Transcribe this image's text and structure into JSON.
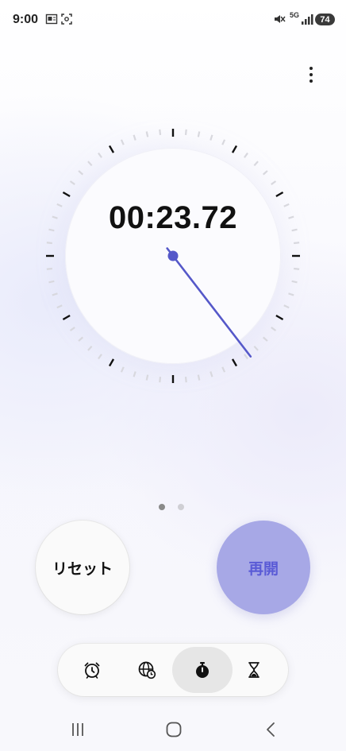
{
  "status_bar": {
    "time": "9:00",
    "battery": "74",
    "network": "5G",
    "icons": [
      "gallery-notification-icon",
      "screenshot-notification-icon",
      "mute-icon",
      "signal-icon",
      "battery-icon"
    ]
  },
  "stopwatch": {
    "time": "00:23.72",
    "elapsed_seconds": 23.72
  },
  "pager": {
    "count": 2,
    "active_index": 0
  },
  "buttons": {
    "reset_label": "リセット",
    "resume_label": "再開"
  },
  "tabs": [
    {
      "id": "alarm",
      "icon": "alarm-clock-icon",
      "active": false
    },
    {
      "id": "world-clock",
      "icon": "world-clock-icon",
      "active": false
    },
    {
      "id": "stopwatch",
      "icon": "stopwatch-icon",
      "active": true
    },
    {
      "id": "timer",
      "icon": "hourglass-icon",
      "active": false
    }
  ],
  "nav": [
    "recent-apps-icon",
    "home-icon",
    "back-icon"
  ],
  "colors": {
    "accent": "#5a5bd6",
    "hand": "#5558c9",
    "resume_bg": "#a7a8e6",
    "tick_major": "#111111",
    "tick_minor": "#d8d8de"
  }
}
